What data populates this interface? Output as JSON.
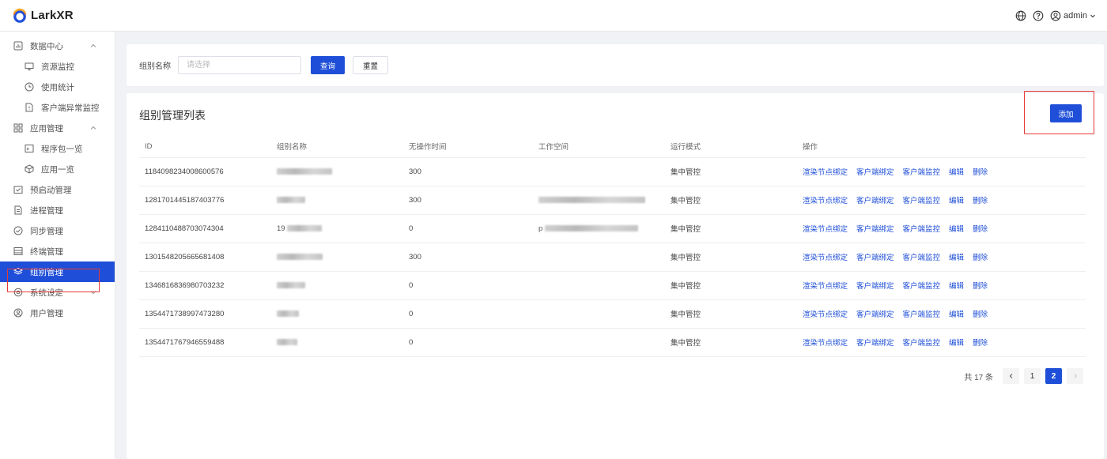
{
  "app": {
    "name": "LarkXR"
  },
  "header": {
    "user": "admin"
  },
  "sidebar": {
    "items": [
      {
        "label": "数据中心",
        "icon": "dashboard-icon",
        "type": "group",
        "expanded": true
      },
      {
        "label": "资源监控",
        "icon": "monitor-icon",
        "type": "sub"
      },
      {
        "label": "使用统计",
        "icon": "clock-icon",
        "type": "sub"
      },
      {
        "label": "客户端异常监控",
        "icon": "file-alert-icon",
        "type": "sub"
      },
      {
        "label": "应用管理",
        "icon": "apps-icon",
        "type": "group",
        "expanded": true
      },
      {
        "label": "程序包一览",
        "icon": "package-icon",
        "type": "sub"
      },
      {
        "label": "应用一览",
        "icon": "cube-icon",
        "type": "sub"
      },
      {
        "label": "预启动管理",
        "icon": "prestart-icon",
        "type": "item"
      },
      {
        "label": "进程管理",
        "icon": "process-icon",
        "type": "item"
      },
      {
        "label": "同步管理",
        "icon": "sync-icon",
        "type": "item"
      },
      {
        "label": "终端管理",
        "icon": "terminal-icon",
        "type": "item"
      },
      {
        "label": "组别管理",
        "icon": "layers-icon",
        "type": "item",
        "active": true
      },
      {
        "label": "系统设定",
        "icon": "settings-icon",
        "type": "group",
        "expanded": false
      },
      {
        "label": "用户管理",
        "icon": "user-icon",
        "type": "item"
      }
    ]
  },
  "filter": {
    "label": "组别名称",
    "placeholder": "请选择",
    "query_label": "查询",
    "reset_label": "重置"
  },
  "list": {
    "title": "组别管理列表",
    "add_label": "添加",
    "columns": [
      "ID",
      "组别名称",
      "无操作时间",
      "工作空间",
      "运行模式",
      "操作"
    ],
    "actions": [
      "渲染节点绑定",
      "客户端绑定",
      "客户端监控",
      "编辑",
      "删除"
    ],
    "rows": [
      {
        "id": "1184098234008600576",
        "name": "",
        "idle": "300",
        "workspace": "",
        "mode": "集中管控"
      },
      {
        "id": "1281701445187403776",
        "name": "",
        "idle": "300",
        "workspace": "",
        "mode": "集中管控"
      },
      {
        "id": "1284110488703074304",
        "name": "19",
        "idle": "0",
        "workspace": "p",
        "mode": "集中管控"
      },
      {
        "id": "1301548205665681408",
        "name": "",
        "idle": "300",
        "workspace": "",
        "mode": "集中管控"
      },
      {
        "id": "1346816836980703232",
        "name": "",
        "idle": "0",
        "workspace": "",
        "mode": "集中管控"
      },
      {
        "id": "1354471738997473280",
        "name": "",
        "idle": "0",
        "workspace": "",
        "mode": "集中管控"
      },
      {
        "id": "1354471767946559488",
        "name": "",
        "idle": "0",
        "workspace": "",
        "mode": "集中管控"
      }
    ]
  },
  "pagination": {
    "total_text": "共 17 条",
    "pages": [
      "1",
      "2"
    ],
    "current": "2"
  },
  "colors": {
    "primary": "#1f4fd8",
    "highlight": "#e53935"
  }
}
